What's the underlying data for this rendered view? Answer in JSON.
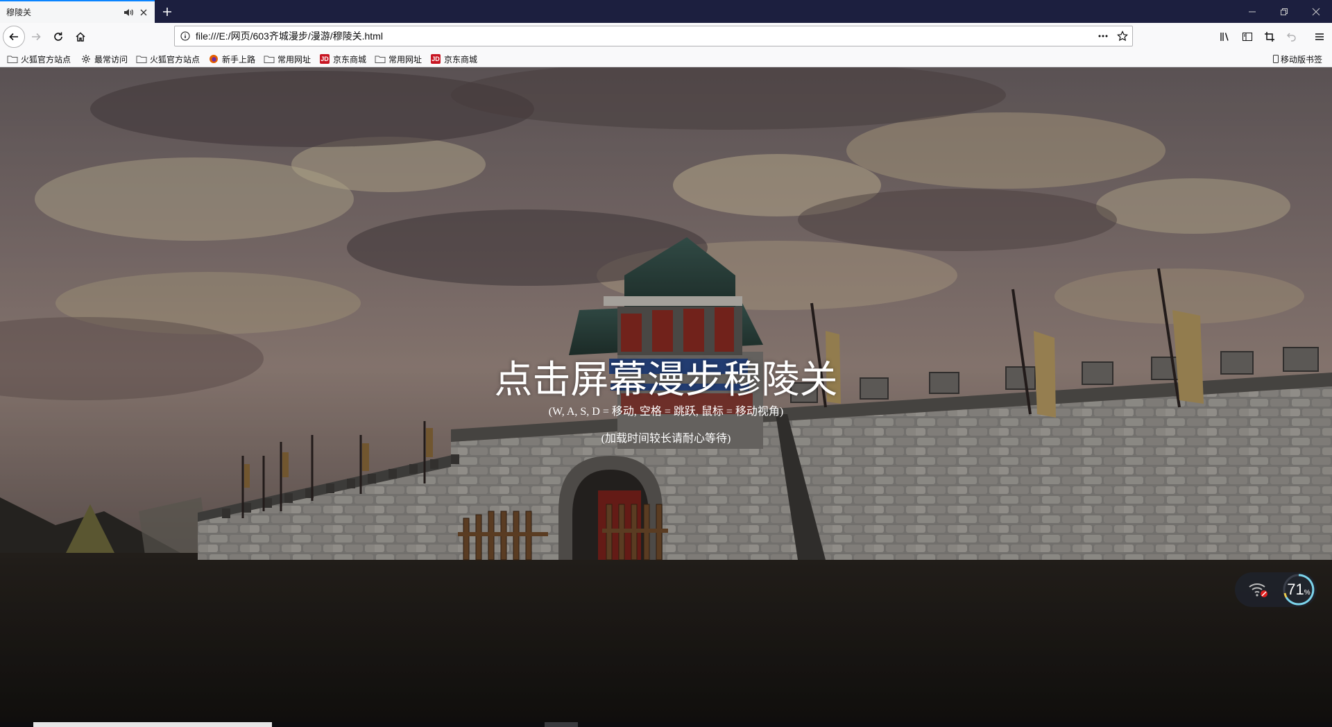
{
  "browser": {
    "tab": {
      "title": "穆陵关"
    },
    "url": "file:///E:/网页/603齐城漫步/漫游/穆陵关.html"
  },
  "bookmarks": [
    {
      "label": "火狐官方站点",
      "icon": "folder-icon"
    },
    {
      "label": "最常访问",
      "icon": "gear-icon"
    },
    {
      "label": "火狐官方站点",
      "icon": "folder-icon"
    },
    {
      "label": "新手上路",
      "icon": "firefox-icon"
    },
    {
      "label": "常用网址",
      "icon": "folder-icon"
    },
    {
      "label": "京东商城",
      "icon": "jd-icon"
    },
    {
      "label": "常用网址",
      "icon": "folder-icon"
    },
    {
      "label": "京东商城",
      "icon": "jd-icon"
    }
  ],
  "mobile_bookmarks": "移动版书签",
  "scene": {
    "title": "点击屏幕漫步穆陵关",
    "controls_hint": "(W, A, S, D = 移动, 空格 = 跳跃, 鼠标 = 移动视角)",
    "loading_hint": "(加载时间较长请耐心等待)"
  },
  "network_widget": {
    "value": "71",
    "unit": "%"
  },
  "colors": {
    "tabstrip": "#1c1f3f",
    "accent": "#0a84ff",
    "jd": "#c81623"
  }
}
